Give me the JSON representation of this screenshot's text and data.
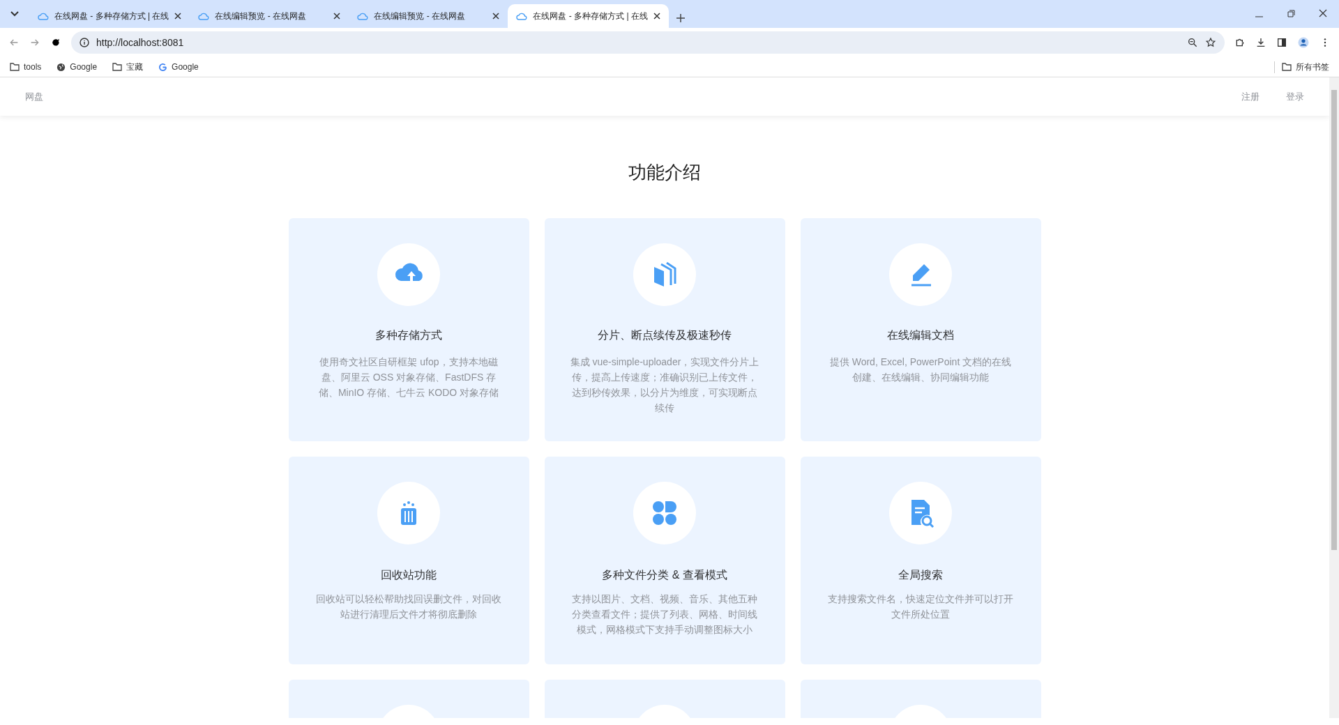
{
  "browser": {
    "tabs": [
      {
        "title": "在线网盘 - 多种存储方式 | 在线",
        "selected": false
      },
      {
        "title": "在线编辑预览 - 在线网盘",
        "selected": false
      },
      {
        "title": "在线编辑预览 - 在线网盘",
        "selected": false
      },
      {
        "title": "在线网盘 - 多种存储方式 | 在线",
        "selected": true
      }
    ],
    "address": "http://localhost:8081",
    "bookmarks": [
      {
        "label": "tools",
        "kind": "folder"
      },
      {
        "label": "Google",
        "kind": "globe"
      },
      {
        "label": "宝藏",
        "kind": "folder"
      },
      {
        "label": "Google",
        "kind": "google"
      }
    ],
    "all_bookmarks": "所有书签"
  },
  "navbar": {
    "brand": "网盘",
    "links": [
      "注册",
      "登录"
    ]
  },
  "section": {
    "title": "功能介绍",
    "features": [
      {
        "title": "多种存储方式",
        "description": "使用奇文社区自研框架 ufop，支持本地磁盘、阿里云 OSS 对象存储、FastDFS 存储、MinIO 存储、七牛云 KODO 对象存储"
      },
      {
        "title": "分片、断点续传及极速秒传",
        "description": "集成 vue-simple-uploader，实现文件分片上传，提高上传速度；准确识别已上传文件，达到秒传效果，以分片为维度，可实现断点续传"
      },
      {
        "title": "在线编辑文档",
        "description": "提供 Word, Excel, PowerPoint 文档的在线创建、在线编辑、协同编辑功能"
      },
      {
        "title": "回收站功能",
        "description": "回收站可以轻松帮助找回误删文件，对回收站进行清理后文件才将彻底删除"
      },
      {
        "title": "多种文件分类 & 查看模式",
        "description": "支持以图片、文档、视频、音乐、其他五种分类查看文件；提供了列表、网格、时间线模式，网格模式下支持手动调整图标大小"
      },
      {
        "title": "全局搜索",
        "description": "支持搜索文件名，快速定位文件并可以打开文件所处位置"
      }
    ]
  }
}
